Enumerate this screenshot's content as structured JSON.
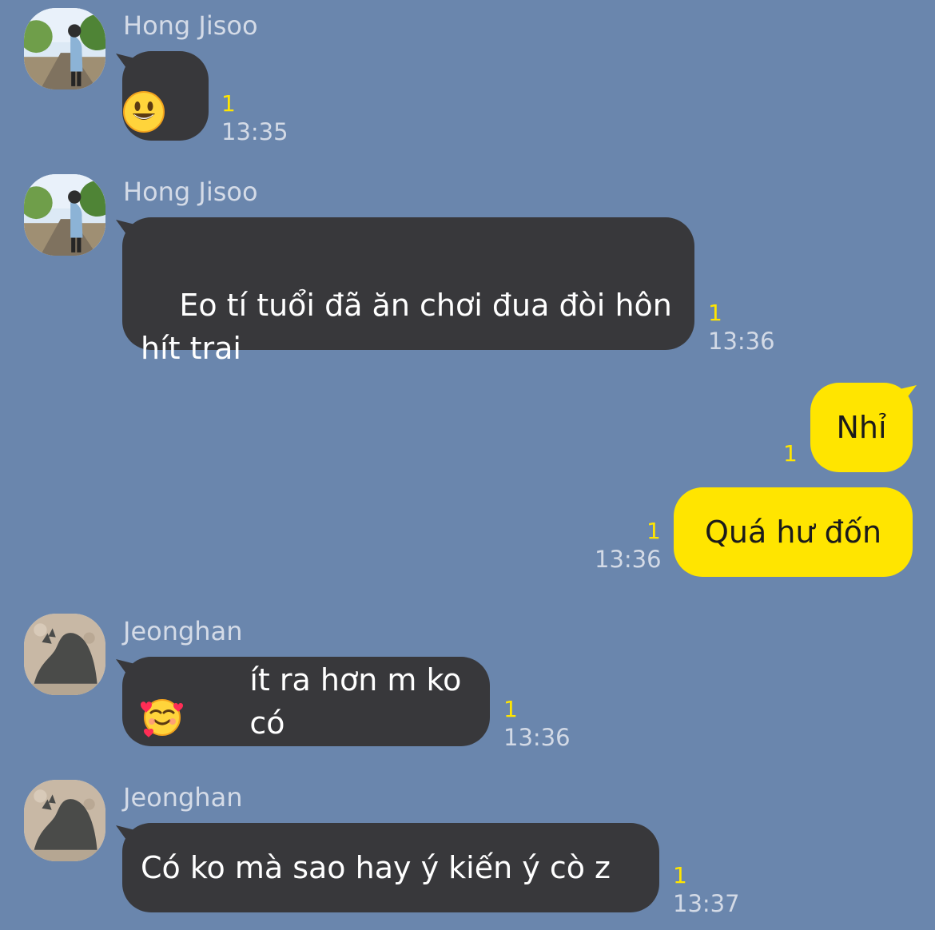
{
  "chat": {
    "messages": [
      {
        "sender": "Hong Jisoo",
        "avatar": "hong-jisoo-avatar",
        "text": "",
        "emoji": "grinning-face",
        "read_count": "1",
        "time": "13:35"
      },
      {
        "sender": "Hong Jisoo",
        "avatar": "hong-jisoo-avatar",
        "text": "Eo tí tuổi đã ăn chơi đua đòi hôn hít trai",
        "read_count": "1",
        "time": "13:36"
      },
      {
        "sender": "me",
        "text": "Nhỉ",
        "read_count": "1",
        "time": ""
      },
      {
        "sender": "me",
        "text": "Quá hư đốn",
        "read_count": "1",
        "time": "13:36"
      },
      {
        "sender": "Jeonghan",
        "avatar": "jeonghan-avatar",
        "emoji": "smiling-face-with-hearts",
        "text": "ít ra hơn m ko có",
        "read_count": "1",
        "time": "13:36"
      },
      {
        "sender": "Jeonghan",
        "avatar": "jeonghan-avatar",
        "text": "Có ko mà sao hay ý kiến ý cò z",
        "read_count": "1",
        "time": "13:37"
      }
    ]
  },
  "colors": {
    "background": "#6a86ad",
    "incoming_bubble": "#38383b",
    "outgoing_bubble": "#ffe500",
    "read_count": "#ffe500",
    "meta_text": "#d3dae6"
  }
}
